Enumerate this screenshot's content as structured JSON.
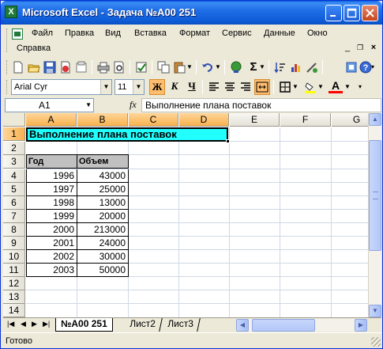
{
  "window": {
    "title": "Microsoft Excel - Задача №А00 251",
    "app_icon_letter": "X",
    "controls": [
      "minimize",
      "maximize",
      "close"
    ]
  },
  "menubar": {
    "items": [
      "Файл",
      "Правка",
      "Вид",
      "Вставка",
      "Формат",
      "Сервис",
      "Данные",
      "Окно",
      "Справка"
    ],
    "doc_controls": [
      "minimize",
      "restore",
      "close"
    ]
  },
  "standard_toolbar": {
    "icons": [
      "new-icon",
      "open-icon",
      "save-icon",
      "permission-icon",
      "email-icon",
      "print-icon",
      "print-preview-icon",
      "spelling-icon",
      "copy-icon",
      "paste-icon",
      "undo-icon",
      "hyperlink-icon",
      "autosum-icon",
      "chart-icon",
      "help-icon"
    ],
    "autosum_label": "Σ"
  },
  "format_toolbar": {
    "font": "Arial Cyr",
    "size": "11",
    "bold_label": "Ж",
    "italic_label": "К",
    "underline_label": "Ч",
    "font_color_label": "A",
    "fill_color": "#ffff00",
    "font_color": "#ff0000"
  },
  "formula_bar": {
    "name_box": "A1",
    "fx_label": "fx",
    "content": "Выполнение плана поставок"
  },
  "grid": {
    "columns": [
      "A",
      "B",
      "C",
      "D",
      "E",
      "F",
      "G"
    ],
    "selected_columns": [
      "A",
      "B",
      "C",
      "D"
    ],
    "rows": [
      "1",
      "2",
      "3",
      "4",
      "5",
      "6",
      "7",
      "8",
      "9",
      "10",
      "11",
      "12",
      "13",
      "14"
    ],
    "selected_row": "1",
    "title_cell": "Выполнение плана поставок",
    "title_fill": "#22ffff",
    "header": [
      "Год",
      "Объем"
    ],
    "data": [
      [
        "1996",
        "43000"
      ],
      [
        "1997",
        "25000"
      ],
      [
        "1998",
        "13000"
      ],
      [
        "1999",
        "20000"
      ],
      [
        "2000",
        "213000"
      ],
      [
        "2001",
        "24000"
      ],
      [
        "2002",
        "30000"
      ],
      [
        "2003",
        "50000"
      ]
    ]
  },
  "sheet_tabs": [
    "№А00 251",
    "Лист2",
    "Лист3"
  ],
  "active_tab": "№А00 251",
  "tab_nav_arrows": [
    "|◀",
    "◀",
    "▶",
    "▶|"
  ],
  "status": "Готово"
}
